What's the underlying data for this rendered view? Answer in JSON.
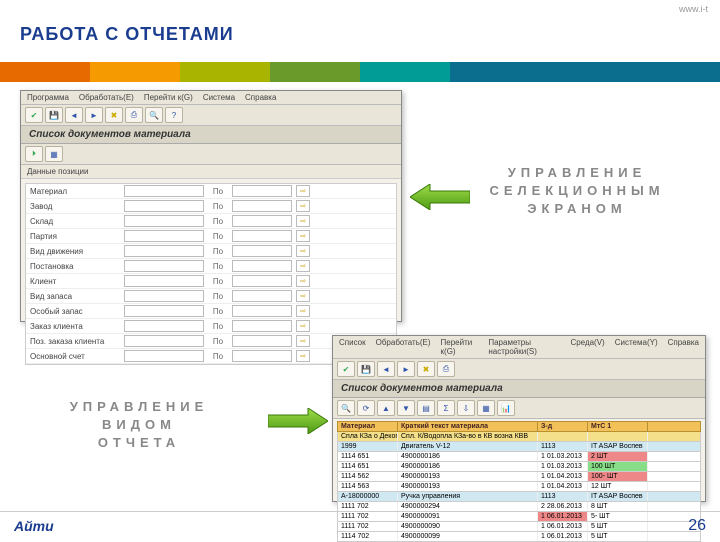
{
  "top_url": "www.i-t",
  "page_title": "РАБОТА С ОТЧЕТАМИ",
  "label1_l1": "УПРАВЛЕНИЕ",
  "label1_l2": "СЕЛЕКЦИОННЫМ",
  "label1_l3": "ЭКРАНОМ",
  "label2_l1": "УПРАВЛЕНИЕ",
  "label2_l2": "ВИДОМ",
  "label2_l3": "ОТЧЕТА",
  "panel1": {
    "menu": [
      "Программа",
      "Обработать(Е)",
      "Перейти к(G)",
      "Система",
      "Справка"
    ],
    "title": "Список документов материала",
    "sub1": "Данные позиции",
    "rows": [
      {
        "lab": "Материал",
        "to": "По"
      },
      {
        "lab": "Завод",
        "to": "По"
      },
      {
        "lab": "Склад",
        "to": "По"
      },
      {
        "lab": "Партия",
        "to": "По"
      },
      {
        "lab": "Вид движения",
        "to": "По"
      },
      {
        "lab": "Постановка",
        "to": "По"
      },
      {
        "lab": "Клиент",
        "to": "По"
      },
      {
        "lab": "Вид запаса",
        "to": "По"
      },
      {
        "lab": "Особый запас",
        "to": "По"
      },
      {
        "lab": "Заказ клиента",
        "to": "По"
      },
      {
        "lab": "Поз. заказа клиента",
        "to": "По"
      },
      {
        "lab": "Основной счет",
        "to": "По"
      }
    ]
  },
  "panel2": {
    "menu": [
      "Список",
      "Обработать(Е)",
      "Перейти к(G)",
      "Параметры настройки(S)",
      "Среда(V)",
      "Система(Y)",
      "Справка"
    ],
    "title": "Список документов материала",
    "hdr": [
      "Материал",
      "Краткий текст материала",
      "З-д",
      "МтС 1"
    ],
    "sub1": {
      "c1": "Спла КЗа о Декоптро",
      "c2": "Спл. К/Водопла КЗа-во в КВ возна КВВ",
      "c3": "",
      "c4": ""
    },
    "sub2": {
      "c1": "1999",
      "c2": "Двигатель V-12",
      "c3": "1113",
      "c4": "IT ASAP Воспев"
    },
    "rows": [
      {
        "c1": "1114 651",
        "c2": "4900000186",
        "c3": "1  01.03.2013",
        "c4": "2  ШТ",
        "cls4": "cell-red"
      },
      {
        "c1": "1114 651",
        "c2": "4900000186",
        "c3": "1  01.03.2013",
        "c4": "100  ШТ",
        "cls4": "cell-grn"
      },
      {
        "c1": "1114 562",
        "c2": "4900000193",
        "c3": "1  01.04.2013",
        "c4": "100- ШТ",
        "cls4": "cell-red"
      },
      {
        "c1": "1114 563",
        "c2": "4900000193",
        "c3": "1  01.04.2013",
        "c4": "12  ШТ",
        "cls4": ""
      }
    ],
    "sub3": {
      "c1": "А-18000000",
      "c2": "Ручка управления",
      "c3": "1113",
      "c4": "IT ASAP Воспев"
    },
    "rows2": [
      {
        "c1": "1111 702",
        "c2": "4900000294",
        "c3": "2  28.06.2013",
        "c4": "8  ШТ",
        "cls4": ""
      },
      {
        "c1": "1111 702",
        "c2": "4900000091",
        "c3": "1  06.01.2013",
        "c4": "5- ШТ",
        "cls3": "cell-red",
        "cls4": ""
      },
      {
        "c1": "1111 702",
        "c2": "4900000090",
        "c3": "1  06.01.2013",
        "c4": "5  ШТ",
        "cls4": ""
      },
      {
        "c1": "1114 702",
        "c2": "4900000099",
        "c3": "1  06.01.2013",
        "c4": "5  ШТ",
        "cls4": ""
      }
    ]
  },
  "page_num": "26",
  "logo": "Айти"
}
